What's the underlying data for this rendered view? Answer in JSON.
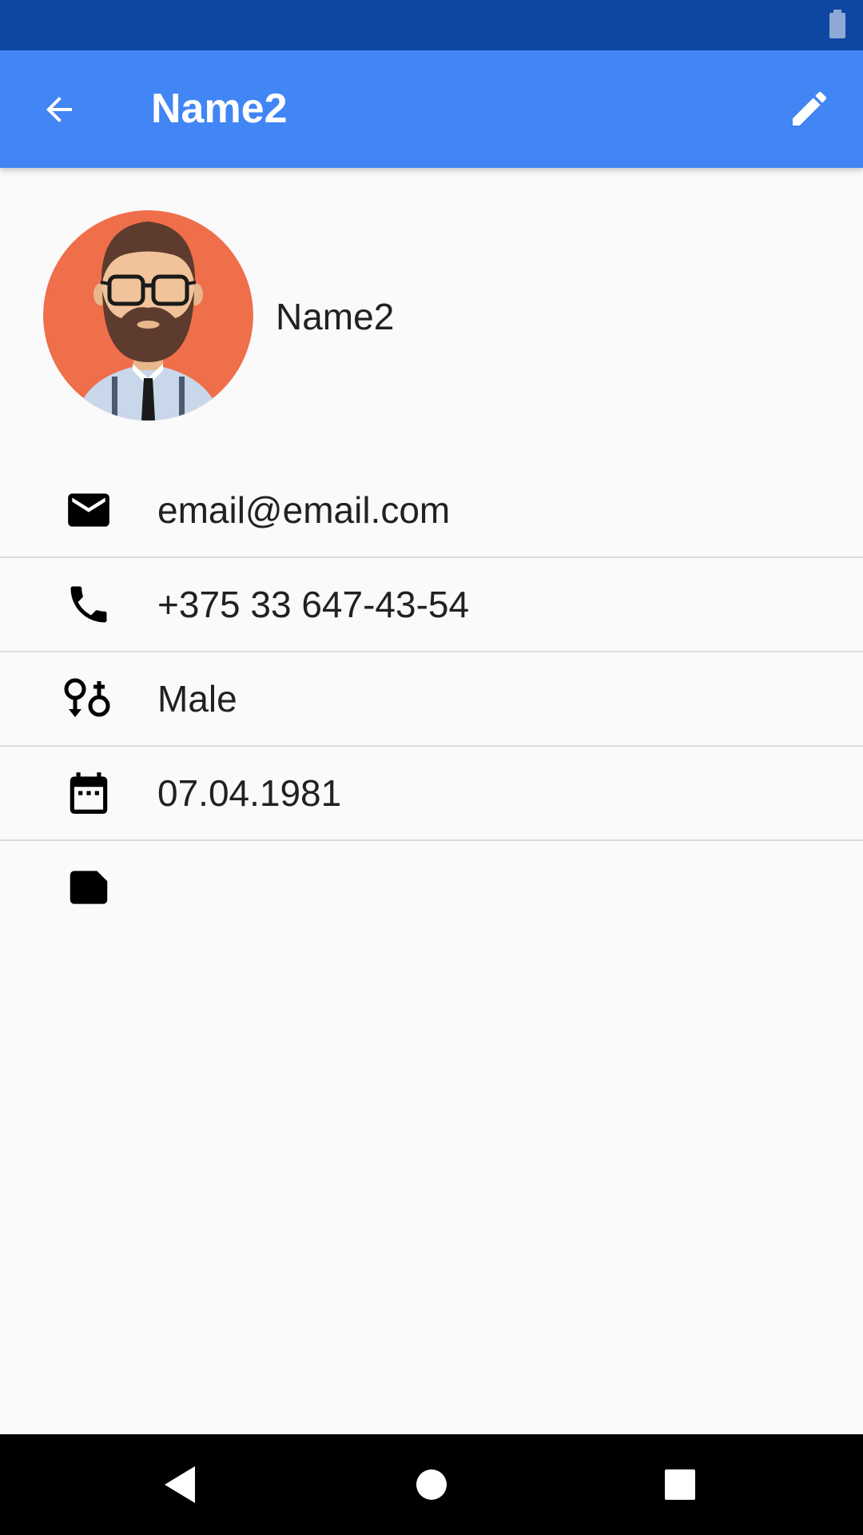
{
  "app_bar": {
    "title": "Name2",
    "back_icon": "arrow-back-icon",
    "edit_icon": "pencil-icon"
  },
  "profile": {
    "name": "Name2",
    "avatar": "bearded-man-avatar"
  },
  "info_rows": [
    {
      "icon": "email-icon",
      "value": "email@email.com"
    },
    {
      "icon": "phone-icon",
      "value": "+375 33 647-43-54"
    },
    {
      "icon": "gender-icon",
      "value": "Male"
    },
    {
      "icon": "calendar-icon",
      "value": "07.04.1981"
    },
    {
      "icon": "note-icon",
      "value": ""
    }
  ],
  "nav_bar": {
    "back_icon": "nav-back-icon",
    "home_icon": "nav-home-icon",
    "recents_icon": "nav-recents-icon"
  },
  "colors": {
    "status_bar": "#0d47a1",
    "app_bar": "#4285f4",
    "avatar_background": "#ef6f4b",
    "background": "#fafafa",
    "divider": "#dcdcdc"
  }
}
